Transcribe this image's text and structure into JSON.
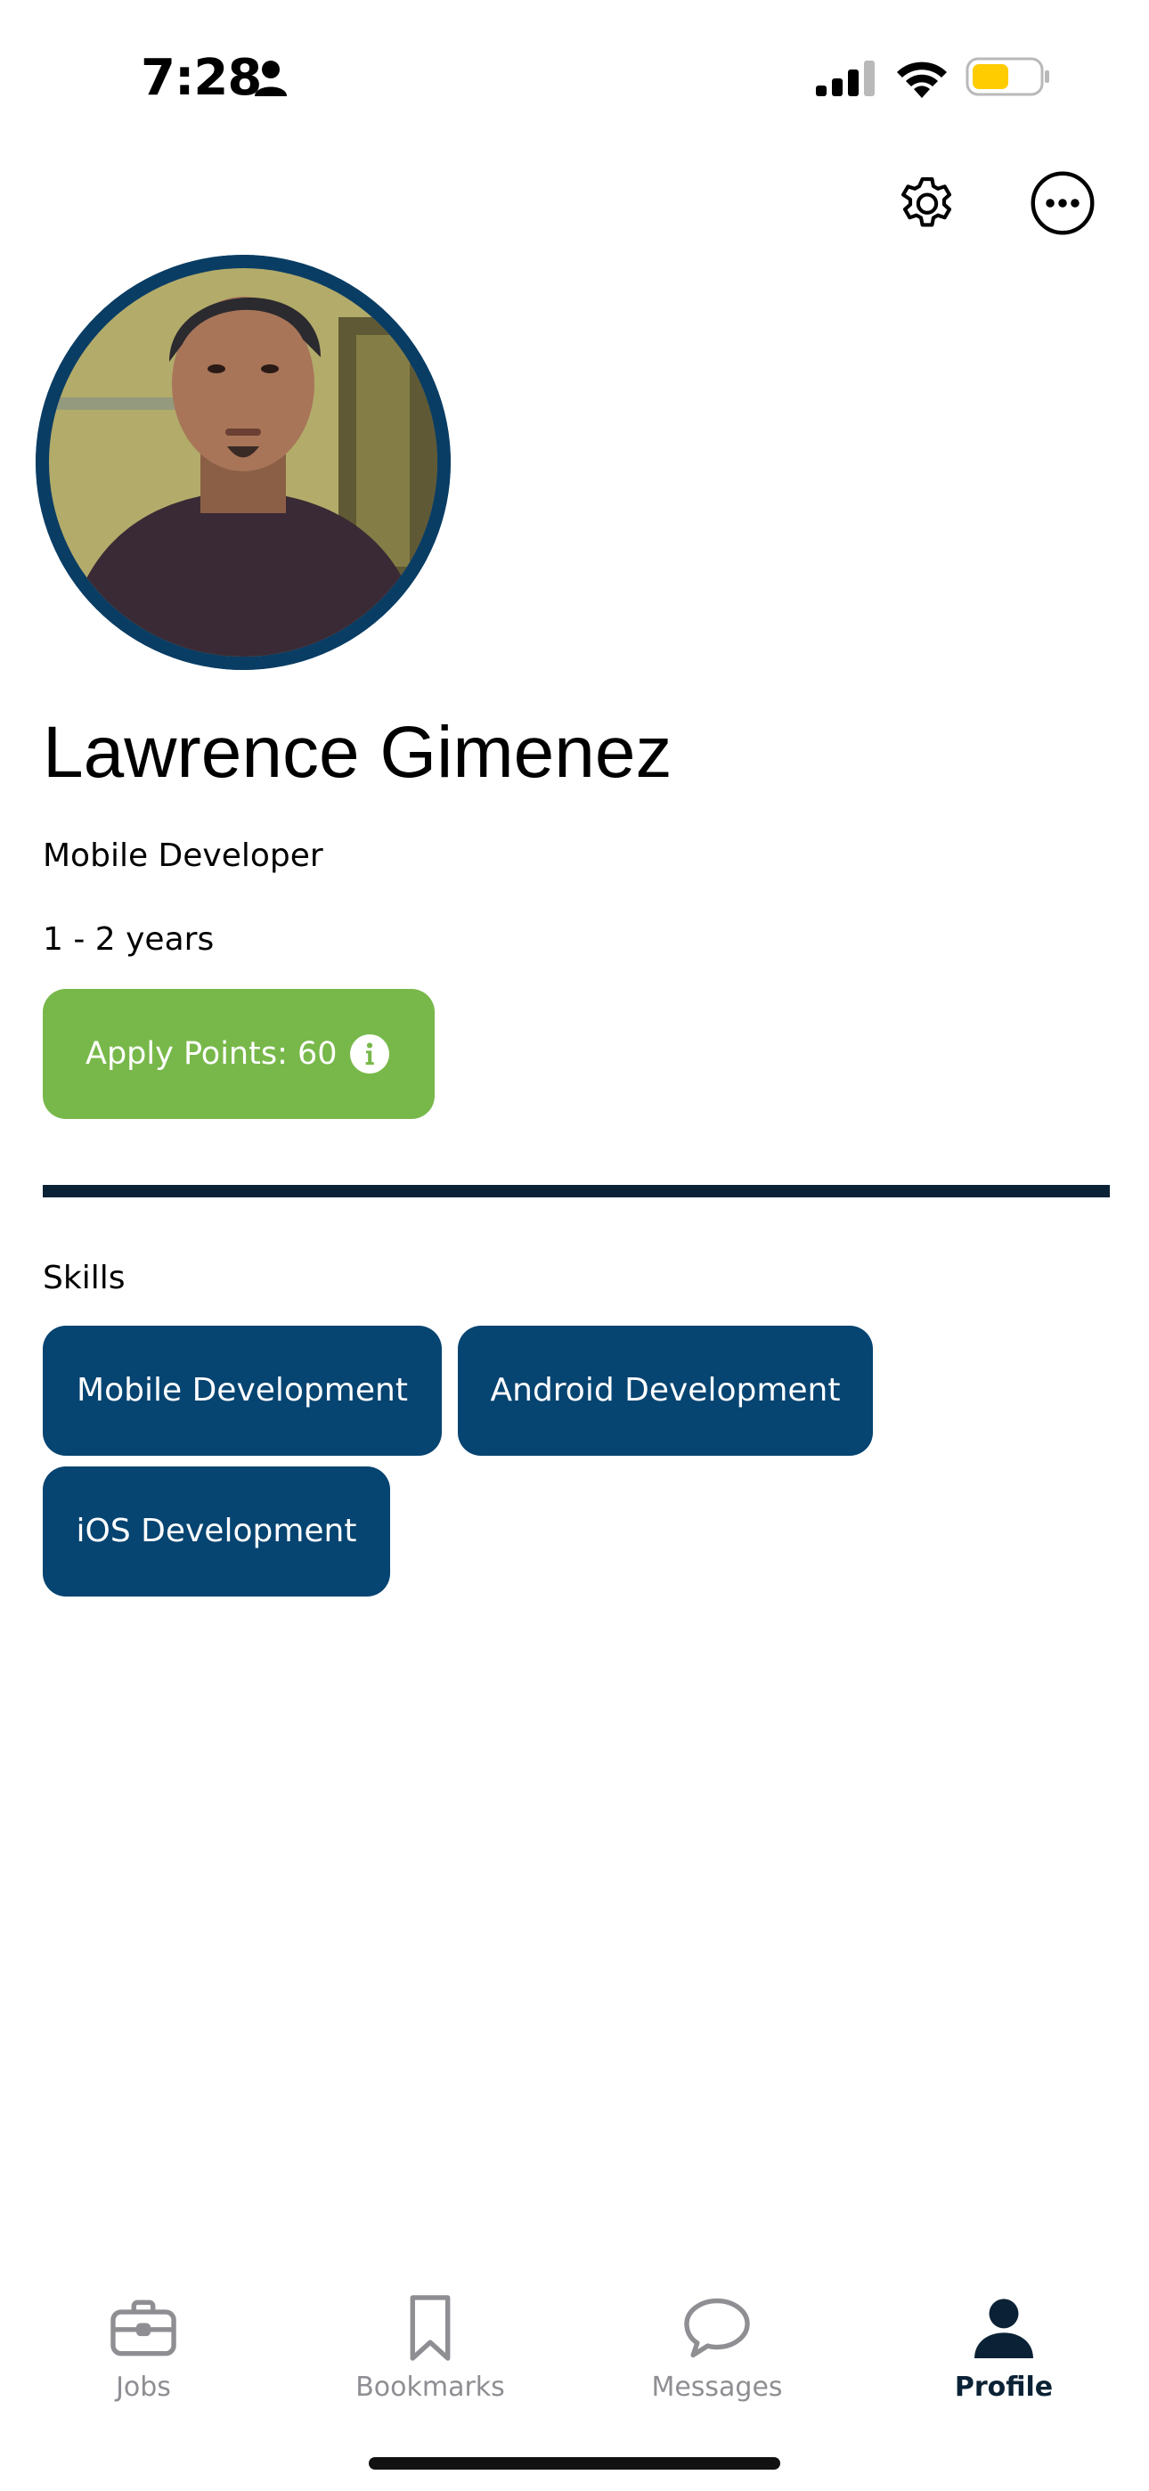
{
  "status_bar": {
    "time": "7:28",
    "battery_color": "#ffcc00"
  },
  "actions": {
    "settings_icon": "gear-icon",
    "more_icon": "more-horizontal-icon"
  },
  "profile": {
    "name": "Lawrence Gimenez",
    "title": "Mobile Developer",
    "experience": "1 - 2 years",
    "apply_points_label": "Apply Points: 60",
    "avatar_ring_color": "#0a3d64"
  },
  "skills": {
    "heading": "Skills",
    "items": [
      "Mobile Development",
      "Android Development",
      "iOS Development"
    ],
    "chip_color": "#064471"
  },
  "apply_points_color": "#78b84a",
  "tabs": [
    {
      "label": "Jobs",
      "icon": "briefcase-icon",
      "active": false
    },
    {
      "label": "Bookmarks",
      "icon": "bookmark-icon",
      "active": false
    },
    {
      "label": "Messages",
      "icon": "chat-bubble-icon",
      "active": false
    },
    {
      "label": "Profile",
      "icon": "person-icon",
      "active": true
    }
  ]
}
